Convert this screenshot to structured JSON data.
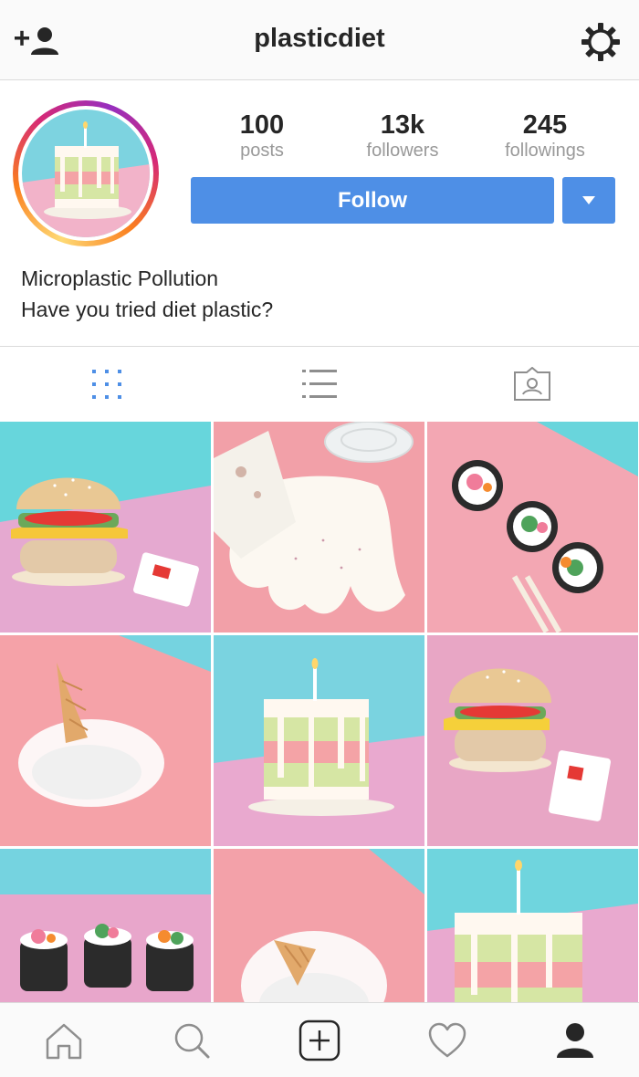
{
  "header": {
    "username": "plasticdiet",
    "left_icon": "add-user-icon",
    "right_icon": "gear-icon"
  },
  "profile": {
    "stats": [
      {
        "value": "100",
        "label": "posts"
      },
      {
        "value": "13k",
        "label": "followers"
      },
      {
        "value": "245",
        "label": "followings"
      }
    ],
    "follow_label": "Follow",
    "dropdown_icon": "caret-down-icon",
    "bio_line1": "Microplastic Pollution",
    "bio_line2": "Have you tried diet plastic?"
  },
  "tabs": [
    {
      "icon": "grid-view-icon",
      "active": true
    },
    {
      "icon": "list-view-icon",
      "active": false
    },
    {
      "icon": "tagged-photos-icon",
      "active": false
    }
  ],
  "posts": [
    {
      "subject": "burger",
      "bg": "#67d6dc"
    },
    {
      "subject": "spilled-cup",
      "bg": "#f2a0a8"
    },
    {
      "subject": "sushi",
      "bg": "#f3a7b3"
    },
    {
      "subject": "ice-cream-cone",
      "bg": "#f5a2a8"
    },
    {
      "subject": "cake",
      "bg": "#7ad3e0"
    },
    {
      "subject": "burger",
      "bg": "#e8a6c5"
    },
    {
      "subject": "sushi",
      "bg": "#75d3e0"
    },
    {
      "subject": "ice-cream-cone",
      "bg": "#f3a1a9"
    },
    {
      "subject": "cake",
      "bg": "#6fd5de"
    }
  ],
  "bottom_nav": [
    {
      "icon": "home-icon"
    },
    {
      "icon": "search-icon"
    },
    {
      "icon": "add-post-icon"
    },
    {
      "icon": "heart-icon"
    },
    {
      "icon": "profile-icon",
      "active": true
    }
  ],
  "colors": {
    "accent": "#4e8fe6",
    "muted": "#999999",
    "text": "#262626"
  }
}
